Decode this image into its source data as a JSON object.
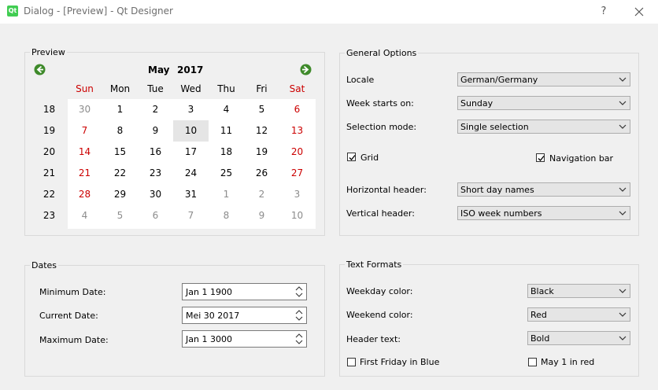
{
  "window": {
    "app_icon_text": "Qt",
    "title": "Dialog - [Preview] - Qt Designer",
    "help_label": "?"
  },
  "preview": {
    "title": "Preview",
    "calendar": {
      "month": "May",
      "year": "2017",
      "day_headers": [
        "Sun",
        "Mon",
        "Tue",
        "Wed",
        "Thu",
        "Fri",
        "Sat"
      ],
      "weekend_color": "#cc0000",
      "other_month_color": "#8c8c8c",
      "selected_bg": "#e5e5e5",
      "weeks": [
        {
          "week": "18",
          "days": [
            {
              "d": "30",
              "o": true
            },
            {
              "d": "1"
            },
            {
              "d": "2"
            },
            {
              "d": "3"
            },
            {
              "d": "4"
            },
            {
              "d": "5"
            },
            {
              "d": "6"
            }
          ]
        },
        {
          "week": "19",
          "days": [
            {
              "d": "7"
            },
            {
              "d": "8"
            },
            {
              "d": "9"
            },
            {
              "d": "10",
              "sel": true
            },
            {
              "d": "11"
            },
            {
              "d": "12"
            },
            {
              "d": "13"
            }
          ]
        },
        {
          "week": "20",
          "days": [
            {
              "d": "14"
            },
            {
              "d": "15"
            },
            {
              "d": "16"
            },
            {
              "d": "17"
            },
            {
              "d": "18"
            },
            {
              "d": "19"
            },
            {
              "d": "20"
            }
          ]
        },
        {
          "week": "21",
          "days": [
            {
              "d": "21"
            },
            {
              "d": "22"
            },
            {
              "d": "23"
            },
            {
              "d": "24"
            },
            {
              "d": "25"
            },
            {
              "d": "26"
            },
            {
              "d": "27"
            }
          ]
        },
        {
          "week": "22",
          "days": [
            {
              "d": "28"
            },
            {
              "d": "29"
            },
            {
              "d": "30"
            },
            {
              "d": "31"
            },
            {
              "d": "1",
              "o": true
            },
            {
              "d": "2",
              "o": true
            },
            {
              "d": "3",
              "o": true
            }
          ]
        },
        {
          "week": "23",
          "days": [
            {
              "d": "4",
              "o": true
            },
            {
              "d": "5",
              "o": true
            },
            {
              "d": "6",
              "o": true
            },
            {
              "d": "7",
              "o": true
            },
            {
              "d": "8",
              "o": true
            },
            {
              "d": "9",
              "o": true
            },
            {
              "d": "10",
              "o": true
            }
          ]
        }
      ]
    }
  },
  "general": {
    "title": "General Options",
    "locale_label": "Locale",
    "locale_value": "German/Germany",
    "week_start_label": "Week starts on:",
    "week_start_value": "Sunday",
    "selection_label": "Selection mode:",
    "selection_value": "Single selection",
    "grid_label": "Grid",
    "grid_checked": true,
    "navbar_label": "Navigation bar",
    "navbar_checked": true,
    "hheader_label": "Horizontal header:",
    "hheader_value": "Short day names",
    "vheader_label": "Vertical header:",
    "vheader_value": "ISO week numbers"
  },
  "dates": {
    "title": "Dates",
    "min_label": "Minimum Date:",
    "min_value": "Jan 1 1900",
    "current_label": "Current Date:",
    "current_value": "Mei 30 2017",
    "max_label": "Maximum Date:",
    "max_value": "Jan 1 3000"
  },
  "text_formats": {
    "title": "Text Formats",
    "weekday_label": "Weekday color:",
    "weekday_value": "Black",
    "weekend_label": "Weekend color:",
    "weekend_value": "Red",
    "header_label": "Header text:",
    "header_value": "Bold",
    "first_friday_label": "First Friday in Blue",
    "first_friday_checked": false,
    "may1_label": "May 1 in red",
    "may1_checked": false
  }
}
